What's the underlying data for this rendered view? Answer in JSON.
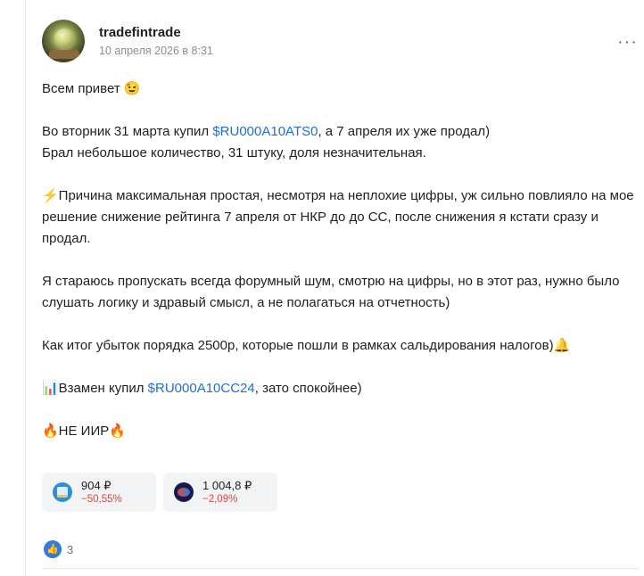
{
  "post": {
    "author": "tradefintrade",
    "date": "10 апреля 2026 в 8:31",
    "more_label": "···",
    "lines": {
      "l1": "Всем привет 😉",
      "l2_pre": "Во вторник 31 марта купил ",
      "l2_ticker": "$RU000A10ATS0",
      "l2_post": ", а 7 апреля их уже продал)",
      "l3": "Брал небольшое количество, 31 штуку, доля незначительная.",
      "l4": "⚡Причина максимальная простая, несмотря на неплохие цифры, уж сильно повлияло на мое решение снижение рейтинга 7 апреля от НКР до до СС, после снижения я кстати сразу и продал.",
      "l5": "Я стараюсь пропускать всегда форумный шум, смотрю на цифры, но в этот раз, нужно было слушать логику и здравый смысл, а не полагаться на отчетность)",
      "l6": "Как итог убыток порядка 2500р, которые пошли в рамках сальдирования налогов)🔔",
      "l7_pre": "📊Взамен купил ",
      "l7_ticker": "$RU000A10CC24",
      "l7_post": ", зато спокойнее)",
      "l8": "🔥НЕ ИИР🔥"
    }
  },
  "instruments": [
    {
      "price": "904 ₽",
      "change": "−50,55%",
      "icon": "bond-issuer-logo"
    },
    {
      "price": "1 004,8 ₽",
      "change": "−2,09%",
      "icon": "bond-issuer-logo"
    }
  ],
  "reactions": {
    "like_icon": "thumbs-up-icon",
    "like_glyph": "👍",
    "count": "3"
  },
  "colors": {
    "link": "#1f6fd1",
    "negative": "#e0433b",
    "like": "#2f7be0"
  }
}
